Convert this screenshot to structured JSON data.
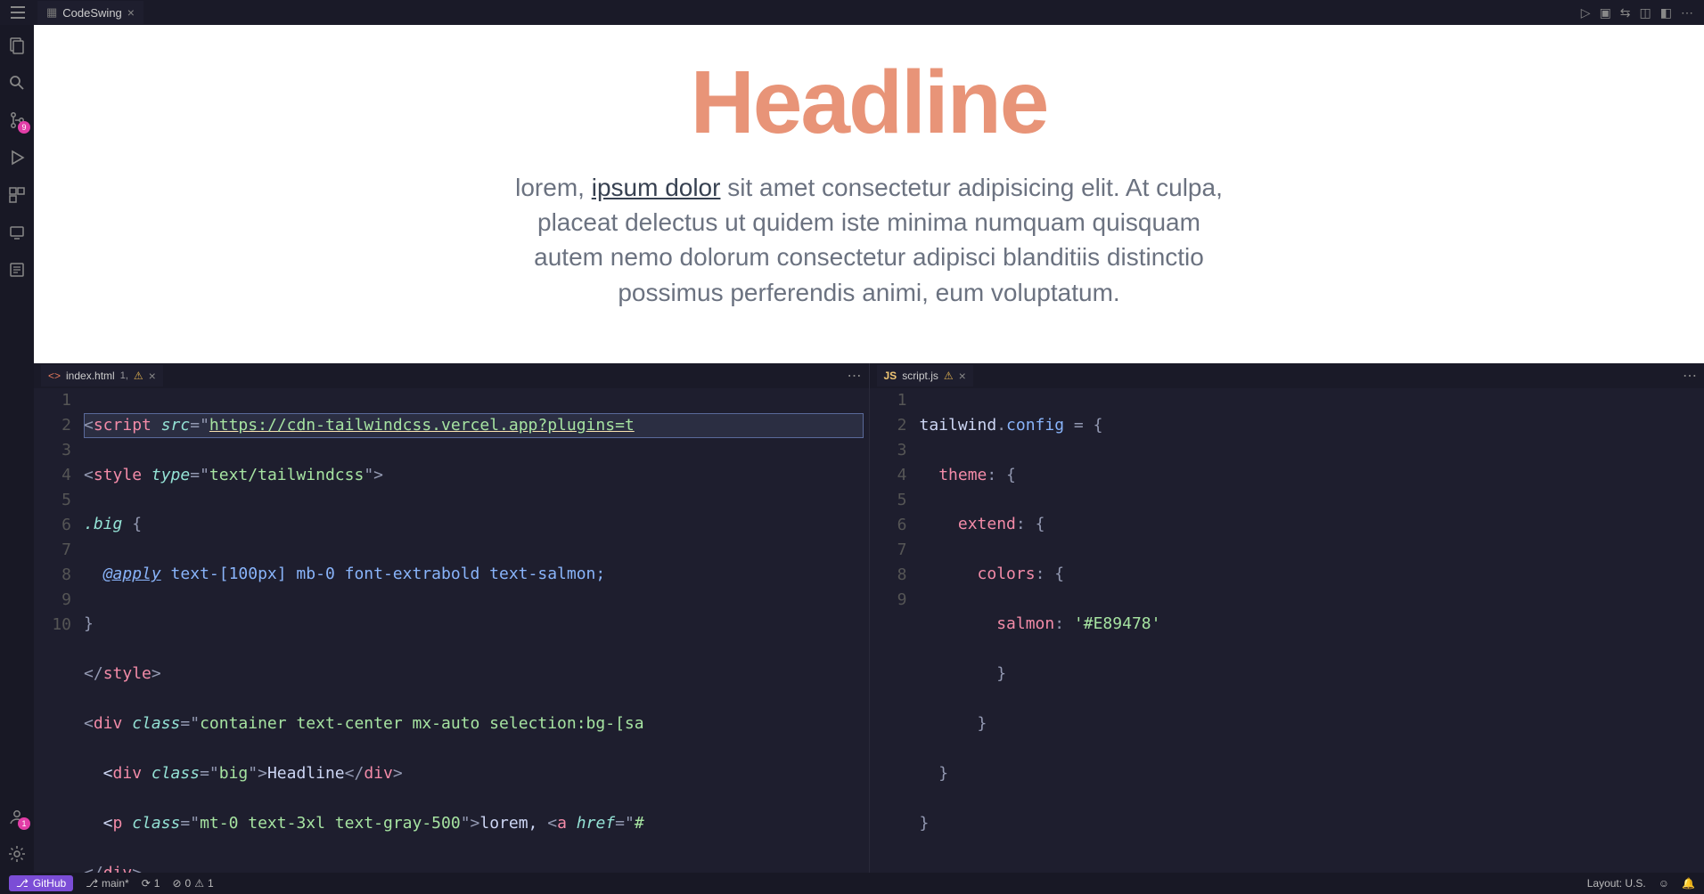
{
  "titlebar": {
    "main_tab_label": "CodeSwing",
    "actions": [
      "run",
      "panel",
      "compare",
      "library",
      "layout",
      "more"
    ]
  },
  "activitybar": {
    "items": [
      "explorer",
      "search",
      "source-control",
      "run-debug",
      "extensions",
      "remote",
      "outline"
    ],
    "scm_badge": "9",
    "account_badge": "1"
  },
  "preview": {
    "headline": "Headline",
    "para_pre": "lorem, ",
    "para_link": "ipsum dolor",
    "para_post": " sit amet consectetur adipisicing elit. At culpa, placeat delectus ut quidem iste minima numquam quisquam autem nemo dolorum consectetur adipisci blanditiis distinctio possimus perferendis animi, eum voluptatum."
  },
  "left_editor": {
    "tab_name": "index.html",
    "tab_problems": "1,",
    "line_numbers": [
      "1",
      "2",
      "3",
      "4",
      "5",
      "6",
      "7",
      "8",
      "9",
      "10"
    ],
    "code": {
      "l1_tag": "script",
      "l1_attr": "src",
      "l1_url": "https://cdn-tailwindcss.vercel.app?plugins=t",
      "l2_tag": "style",
      "l2_attr": "type",
      "l2_val": "text/tailwindcss",
      "l3_class": ".big",
      "l3_brace": " {",
      "l4_at": "@apply",
      "l4_rest": " text-[100px] mb-0 font-extrabold text-salmon;",
      "l5": "}",
      "l6_close": "</",
      "l6_tag": "style",
      "l6_gt": ">",
      "l7_tag": "div",
      "l7_attr": "class",
      "l7_val": "container text-center mx-auto selection:bg-[sa",
      "l8_pre": "  <",
      "l8_tag": "div",
      "l8_attr": "class",
      "l8_val": "big",
      "l8_text": "Headline",
      "l8_close": "div",
      "l9_pre": "  <",
      "l9_tag": "p",
      "l9_attr": "class",
      "l9_val": "mt-0 text-3xl text-gray-500",
      "l9_text": "lorem, ",
      "l9_tag2": "a",
      "l9_attr2": "href",
      "l9_val2": "#",
      "l10_close": "</",
      "l10_tag": "div",
      "l10_gt": ">"
    }
  },
  "right_editor": {
    "tab_name": "script.js",
    "line_numbers": [
      "1",
      "2",
      "3",
      "4",
      "5",
      "6",
      "7",
      "8",
      "9"
    ],
    "code": {
      "l1_a": "tailwind",
      "l1_b": ".",
      "l1_c": "config",
      "l1_d": " = {",
      "l2_k": "theme",
      "l2_r": ": {",
      "l3_k": "extend",
      "l3_r": ": {",
      "l4_k": "colors",
      "l4_r": ": {",
      "l5_k": "salmon",
      "l5_c": ": ",
      "l5_v": "'#E89478'",
      "l6": "}",
      "l7": "}",
      "l8": "}",
      "l9": "}"
    }
  },
  "statusbar": {
    "github": "GitHub",
    "branch": "main*",
    "sync": "1",
    "errors": "0",
    "warnings": "1",
    "layout": "Layout: U.S."
  }
}
